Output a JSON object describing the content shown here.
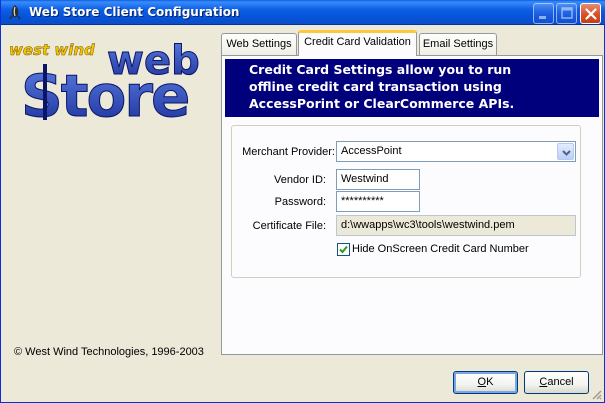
{
  "window": {
    "title": "Web Store Client Configuration",
    "controls": [
      "minimize",
      "maximize",
      "close"
    ]
  },
  "logo": {
    "line1": "west wind",
    "line2": "web",
    "line3": "Store"
  },
  "copyright": "© West Wind Technologies, 1996-2003",
  "tabs": [
    {
      "label": "Web Settings",
      "active": false
    },
    {
      "label": "Credit Card Validation",
      "active": true
    },
    {
      "label": "Email Settings",
      "active": false
    }
  ],
  "banner": {
    "lines": [
      "Credit Card Settings allow you to run",
      "offline credit card transaction using",
      "AccessPorint or ClearCommerce APIs."
    ]
  },
  "form": {
    "merchant_provider_label": "Merchant Provider:",
    "merchant_provider_value": "AccessPoint",
    "vendor_id_label": "Vendor ID:",
    "vendor_id_value": "Westwind",
    "password_label": "Password:",
    "password_value": "**********",
    "certificate_label": "Certificate File:",
    "certificate_value": "d:\\wwapps\\wc3\\tools\\westwind.pem",
    "hide_cc_label": "Hide OnScreen Credit Card Number",
    "hide_cc_checked": true
  },
  "buttons": {
    "ok_mnemonic": "O",
    "ok_rest": "K",
    "cancel_mnemonic": "C",
    "cancel_rest": "ancel"
  },
  "colors": {
    "titlebar": "#0a5ee8",
    "banner": "#00007d",
    "active_tab_accent": "#ffc83c",
    "face": "#ece9d8"
  }
}
